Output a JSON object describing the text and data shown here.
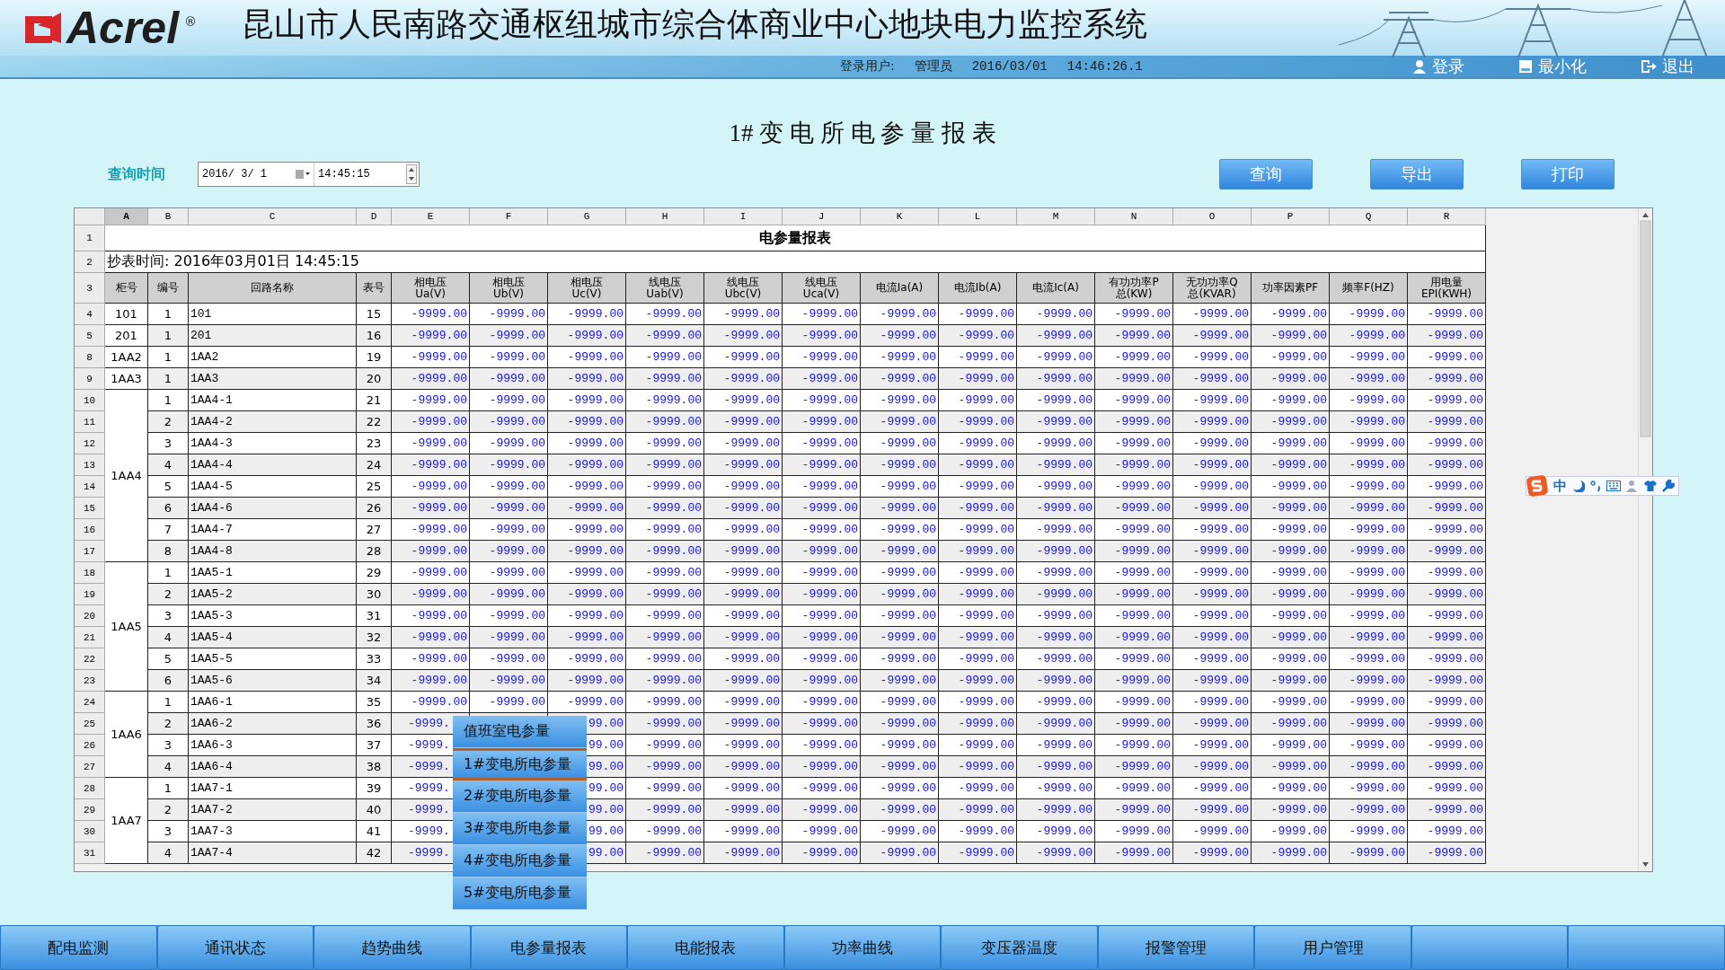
{
  "header": {
    "logo": "Acrel",
    "logo_mark": "®",
    "title": "昆山市人民南路交通枢纽城市综合体商业中心地块电力监控系统",
    "user_label": "登录用户:",
    "user": "管理员",
    "date": "2016/03/01",
    "time": "14:46:26.1",
    "actions": [
      {
        "kind": "login",
        "label": "登录"
      },
      {
        "kind": "minimize",
        "label": "最小化"
      },
      {
        "kind": "exit",
        "label": "退出"
      }
    ]
  },
  "report_title": "1# 变 电 所 电 参 量 报 表",
  "query": {
    "label": "查询时间",
    "date": "2016/ 3/ 1",
    "time": "14:45:15",
    "buttons": [
      "查询",
      "导出",
      "打印"
    ]
  },
  "sheet": {
    "columns": [
      {
        "label": "A",
        "selected": true
      },
      {
        "label": "B",
        "selected": false
      },
      {
        "label": "C",
        "selected": false
      },
      {
        "label": "D",
        "selected": false
      },
      {
        "label": "E",
        "selected": false
      },
      {
        "label": "F",
        "selected": false
      },
      {
        "label": "G",
        "selected": false
      },
      {
        "label": "H",
        "selected": false
      },
      {
        "label": "I",
        "selected": false
      },
      {
        "label": "J",
        "selected": false
      },
      {
        "label": "K",
        "selected": false
      },
      {
        "label": "L",
        "selected": false
      },
      {
        "label": "M",
        "selected": false
      },
      {
        "label": "N",
        "selected": false
      },
      {
        "label": "O",
        "selected": false
      },
      {
        "label": "P",
        "selected": false
      },
      {
        "label": "Q",
        "selected": false
      },
      {
        "label": "R",
        "selected": false
      }
    ],
    "title_row": {
      "row_number": "1",
      "text": "电参量报表"
    },
    "reading_row": {
      "row_number": "2",
      "text": "抄表时间: 2016年03月01日 14:45:15"
    },
    "header_row": {
      "row_number": "3",
      "labels": [
        "柜号",
        "编号",
        "回路名称",
        "表号",
        "相电压\nUa(V)",
        "相电压\nUb(V)",
        "相电压\nUc(V)",
        "线电压\nUab(V)",
        "线电压\nUbc(V)",
        "线电压\nUca(V)",
        "电流Ia(A)",
        "电流Ib(A)",
        "电流Ic(A)",
        "有功功率P\n总(KW)",
        "无功功率Q\n总(KVAR)",
        "功率因素PF",
        "频率F(HZ)",
        "用电量\nEPI(KWH)"
      ]
    },
    "groups": [
      {
        "cabinet": "101",
        "rows": [
          {
            "kind": "full",
            "row_number": "4",
            "no": "1",
            "circuit": "101",
            "meter": "15",
            "values": [
              "-9999.00",
              "-9999.00",
              "-9999.00",
              "-9999.00",
              "-9999.00",
              "-9999.00",
              "-9999.00",
              "-9999.00",
              "-9999.00",
              "-9999.00",
              "-9999.00",
              "-9999.00",
              "-9999.00",
              "-9999.00"
            ]
          }
        ]
      },
      {
        "cabinet": "201",
        "rows": [
          {
            "kind": "full",
            "row_number": "5",
            "no": "1",
            "circuit": "201",
            "meter": "16",
            "values": [
              "-9999.00",
              "-9999.00",
              "-9999.00",
              "-9999.00",
              "-9999.00",
              "-9999.00",
              "-9999.00",
              "-9999.00",
              "-9999.00",
              "-9999.00",
              "-9999.00",
              "-9999.00",
              "-9999.00",
              "-9999.00"
            ]
          }
        ]
      },
      {
        "cabinet": "1AA2",
        "rows": [
          {
            "kind": "full",
            "row_number": "8",
            "no": "1",
            "circuit": "1AA2",
            "meter": "19",
            "values": [
              "-9999.00",
              "-9999.00",
              "-9999.00",
              "-9999.00",
              "-9999.00",
              "-9999.00",
              "-9999.00",
              "-9999.00",
              "-9999.00",
              "-9999.00",
              "-9999.00",
              "-9999.00",
              "-9999.00",
              "-9999.00"
            ]
          }
        ]
      },
      {
        "cabinet": "1AA3",
        "rows": [
          {
            "kind": "full",
            "row_number": "9",
            "no": "1",
            "circuit": "1AA3",
            "meter": "20",
            "values": [
              "-9999.00",
              "-9999.00",
              "-9999.00",
              "-9999.00",
              "-9999.00",
              "-9999.00",
              "-9999.00",
              "-9999.00",
              "-9999.00",
              "-9999.00",
              "-9999.00",
              "-9999.00",
              "-9999.00",
              "-9999.00"
            ]
          }
        ]
      },
      {
        "cabinet": "1AA4",
        "rows": [
          {
            "kind": "full",
            "row_number": "10",
            "no": "1",
            "circuit": "1AA4-1",
            "meter": "21",
            "values": [
              "-9999.00",
              "-9999.00",
              "-9999.00",
              "-9999.00",
              "-9999.00",
              "-9999.00",
              "-9999.00",
              "-9999.00",
              "-9999.00",
              "-9999.00",
              "-9999.00",
              "-9999.00",
              "-9999.00",
              "-9999.00"
            ]
          },
          {
            "kind": "full",
            "row_number": "11",
            "no": "2",
            "circuit": "1AA4-2",
            "meter": "22",
            "values": [
              "-9999.00",
              "-9999.00",
              "-9999.00",
              "-9999.00",
              "-9999.00",
              "-9999.00",
              "-9999.00",
              "-9999.00",
              "-9999.00",
              "-9999.00",
              "-9999.00",
              "-9999.00",
              "-9999.00",
              "-9999.00"
            ]
          },
          {
            "kind": "full",
            "row_number": "12",
            "no": "3",
            "circuit": "1AA4-3",
            "meter": "23",
            "values": [
              "-9999.00",
              "-9999.00",
              "-9999.00",
              "-9999.00",
              "-9999.00",
              "-9999.00",
              "-9999.00",
              "-9999.00",
              "-9999.00",
              "-9999.00",
              "-9999.00",
              "-9999.00",
              "-9999.00",
              "-9999.00"
            ]
          },
          {
            "kind": "full",
            "row_number": "13",
            "no": "4",
            "circuit": "1AA4-4",
            "meter": "24",
            "values": [
              "-9999.00",
              "-9999.00",
              "-9999.00",
              "-9999.00",
              "-9999.00",
              "-9999.00",
              "-9999.00",
              "-9999.00",
              "-9999.00",
              "-9999.00",
              "-9999.00",
              "-9999.00",
              "-9999.00",
              "-9999.00"
            ]
          },
          {
            "kind": "full",
            "row_number": "14",
            "no": "5",
            "circuit": "1AA4-5",
            "meter": "25",
            "values": [
              "-9999.00",
              "-9999.00",
              "-9999.00",
              "-9999.00",
              "-9999.00",
              "-9999.00",
              "-9999.00",
              "-9999.00",
              "-9999.00",
              "-9999.00",
              "-9999.00",
              "-9999.00",
              "-9999.00",
              "-9999.00"
            ]
          },
          {
            "kind": "full",
            "row_number": "15",
            "no": "6",
            "circuit": "1AA4-6",
            "meter": "26",
            "values": [
              "-9999.00",
              "-9999.00",
              "-9999.00",
              "-9999.00",
              "-9999.00",
              "-9999.00",
              "-9999.00",
              "-9999.00",
              "-9999.00",
              "-9999.00",
              "-9999.00",
              "-9999.00",
              "-9999.00",
              "-9999.00"
            ]
          },
          {
            "kind": "full",
            "row_number": "16",
            "no": "7",
            "circuit": "1AA4-7",
            "meter": "27",
            "values": [
              "-9999.00",
              "-9999.00",
              "-9999.00",
              "-9999.00",
              "-9999.00",
              "-9999.00",
              "-9999.00",
              "-9999.00",
              "-9999.00",
              "-9999.00",
              "-9999.00",
              "-9999.00",
              "-9999.00",
              "-9999.00"
            ]
          },
          {
            "kind": "full",
            "row_number": "17",
            "no": "8",
            "circuit": "1AA4-8",
            "meter": "28",
            "values": [
              "-9999.00",
              "-9999.00",
              "-9999.00",
              "-9999.00",
              "-9999.00",
              "-9999.00",
              "-9999.00",
              "-9999.00",
              "-9999.00",
              "-9999.00",
              "-9999.00",
              "-9999.00",
              "-9999.00",
              "-9999.00"
            ]
          }
        ]
      },
      {
        "cabinet": "1AA5",
        "rows": [
          {
            "kind": "full",
            "row_number": "18",
            "no": "1",
            "circuit": "1AA5-1",
            "meter": "29",
            "values": [
              "-9999.00",
              "-9999.00",
              "-9999.00",
              "-9999.00",
              "-9999.00",
              "-9999.00",
              "-9999.00",
              "-9999.00",
              "-9999.00",
              "-9999.00",
              "-9999.00",
              "-9999.00",
              "-9999.00",
              "-9999.00"
            ]
          },
          {
            "kind": "full",
            "row_number": "19",
            "no": "2",
            "circuit": "1AA5-2",
            "meter": "30",
            "values": [
              "-9999.00",
              "-9999.00",
              "-9999.00",
              "-9999.00",
              "-9999.00",
              "-9999.00",
              "-9999.00",
              "-9999.00",
              "-9999.00",
              "-9999.00",
              "-9999.00",
              "-9999.00",
              "-9999.00",
              "-9999.00"
            ]
          },
          {
            "kind": "full",
            "row_number": "20",
            "no": "3",
            "circuit": "1AA5-3",
            "meter": "31",
            "values": [
              "-9999.00",
              "-9999.00",
              "-9999.00",
              "-9999.00",
              "-9999.00",
              "-9999.00",
              "-9999.00",
              "-9999.00",
              "-9999.00",
              "-9999.00",
              "-9999.00",
              "-9999.00",
              "-9999.00",
              "-9999.00"
            ]
          },
          {
            "kind": "full",
            "row_number": "21",
            "no": "4",
            "circuit": "1AA5-4",
            "meter": "32",
            "values": [
              "-9999.00",
              "-9999.00",
              "-9999.00",
              "-9999.00",
              "-9999.00",
              "-9999.00",
              "-9999.00",
              "-9999.00",
              "-9999.00",
              "-9999.00",
              "-9999.00",
              "-9999.00",
              "-9999.00",
              "-9999.00"
            ]
          },
          {
            "kind": "full",
            "row_number": "22",
            "no": "5",
            "circuit": "1AA5-5",
            "meter": "33",
            "values": [
              "-9999.00",
              "-9999.00",
              "-9999.00",
              "-9999.00",
              "-9999.00",
              "-9999.00",
              "-9999.00",
              "-9999.00",
              "-9999.00",
              "-9999.00",
              "-9999.00",
              "-9999.00",
              "-9999.00",
              "-9999.00"
            ]
          },
          {
            "kind": "full",
            "row_number": "23",
            "no": "6",
            "circuit": "1AA5-6",
            "meter": "34",
            "values": [
              "-9999.00",
              "-9999.00",
              "-9999.00",
              "-9999.00",
              "-9999.00",
              "-9999.00",
              "-9999.00",
              "-9999.00",
              "-9999.00",
              "-9999.00",
              "-9999.00",
              "-9999.00",
              "-9999.00",
              "-9999.00"
            ]
          }
        ]
      },
      {
        "cabinet": "1AA6",
        "rows": [
          {
            "kind": "full",
            "row_number": "24",
            "no": "1",
            "circuit": "1AA6-1",
            "meter": "35",
            "values": [
              "-9999.00",
              "-9999.00",
              "-9999.00",
              "-9999.00",
              "-9999.00",
              "-9999.00",
              "-9999.00",
              "-9999.00",
              "-9999.00",
              "-9999.00",
              "-9999.00",
              "-9999.00",
              "-9999.00",
              "-9999.00"
            ]
          },
          {
            "kind": "covered",
            "row_number": "25",
            "no": "2",
            "circuit": "1AA6-2",
            "meter": "36",
            "values": [
              "-9999.",
              "99.00",
              "-9999.00",
              "-9999.00",
              "-9999.00",
              "-9999.00",
              "-9999.00",
              "-9999.00",
              "-9999.00",
              "-9999.00",
              "-9999.00",
              "-9999.00",
              "-9999.00"
            ]
          },
          {
            "kind": "covered",
            "row_number": "26",
            "no": "3",
            "circuit": "1AA6-3",
            "meter": "37",
            "values": [
              "-9999.",
              "99.00",
              "-9999.00",
              "-9999.00",
              "-9999.00",
              "-9999.00",
              "-9999.00",
              "-9999.00",
              "-9999.00",
              "-9999.00",
              "-9999.00",
              "-9999.00",
              "-9999.00"
            ]
          },
          {
            "kind": "covered",
            "row_number": "27",
            "no": "4",
            "circuit": "1AA6-4",
            "meter": "38",
            "values": [
              "-9999.",
              "99.00",
              "-9999.00",
              "-9999.00",
              "-9999.00",
              "-9999.00",
              "-9999.00",
              "-9999.00",
              "-9999.00",
              "-9999.00",
              "-9999.00",
              "-9999.00",
              "-9999.00"
            ]
          }
        ]
      },
      {
        "cabinet": "1AA7",
        "rows": [
          {
            "kind": "covered",
            "row_number": "28",
            "no": "1",
            "circuit": "1AA7-1",
            "meter": "39",
            "values": [
              "-9999.",
              "99.00",
              "-9999.00",
              "-9999.00",
              "-9999.00",
              "-9999.00",
              "-9999.00",
              "-9999.00",
              "-9999.00",
              "-9999.00",
              "-9999.00",
              "-9999.00",
              "-9999.00"
            ]
          },
          {
            "kind": "covered",
            "row_number": "29",
            "no": "2",
            "circuit": "1AA7-2",
            "meter": "40",
            "values": [
              "-9999.",
              "99.00",
              "-9999.00",
              "-9999.00",
              "-9999.00",
              "-9999.00",
              "-9999.00",
              "-9999.00",
              "-9999.00",
              "-9999.00",
              "-9999.00",
              "-9999.00",
              "-9999.00"
            ]
          },
          {
            "kind": "covered",
            "row_number": "30",
            "no": "3",
            "circuit": "1AA7-3",
            "meter": "41",
            "values": [
              "-9999.",
              "99.00",
              "-9999.00",
              "-9999.00",
              "-9999.00",
              "-9999.00",
              "-9999.00",
              "-9999.00",
              "-9999.00",
              "-9999.00",
              "-9999.00",
              "-9999.00",
              "-9999.00"
            ]
          },
          {
            "kind": "covered",
            "row_number": "31",
            "no": "4",
            "circuit": "1AA7-4",
            "meter": "42",
            "values": [
              "-9999.",
              "99.00",
              "-9999.00",
              "-9999.00",
              "-9999.00",
              "-9999.00",
              "-9999.00",
              "-9999.00",
              "-9999.00",
              "-9999.00",
              "-9999.00",
              "-9999.00",
              "-9999.00"
            ]
          }
        ]
      }
    ]
  },
  "popup_menu": {
    "items": [
      {
        "label": "值班室电参量",
        "selected": false
      },
      {
        "label": "1#变电所电参量",
        "selected": true
      },
      {
        "label": "2#变电所电参量",
        "selected": false
      },
      {
        "label": "3#变电所电参量",
        "selected": false
      },
      {
        "label": "4#变电所电参量",
        "selected": false
      },
      {
        "label": "5#变电所电参量",
        "selected": false
      }
    ]
  },
  "ime_toolbar": {
    "mode": "中"
  },
  "nav": [
    {
      "label": "配电监测"
    },
    {
      "label": "通讯状态"
    },
    {
      "label": "趋势曲线"
    },
    {
      "label": "电参量报表"
    },
    {
      "label": "电能报表"
    },
    {
      "label": "功率曲线"
    },
    {
      "label": "变压器温度"
    },
    {
      "label": "报警管理"
    },
    {
      "label": "用户管理"
    }
  ]
}
